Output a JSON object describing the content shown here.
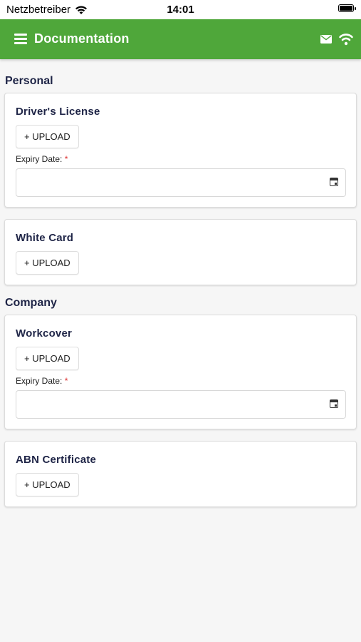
{
  "status_bar": {
    "carrier": "Netzbetreiber",
    "time": "14:01"
  },
  "app_bar": {
    "title": "Documentation",
    "color": "#4fa73a"
  },
  "sections": [
    {
      "title": "Personal",
      "cards": [
        {
          "title": "Driver's License",
          "upload_label": "+ UPLOAD",
          "expiry_label": "Expiry Date:",
          "required_mark": "*",
          "expiry_value": ""
        },
        {
          "title": "White Card",
          "upload_label": "+ UPLOAD"
        }
      ]
    },
    {
      "title": "Company",
      "cards": [
        {
          "title": "Workcover",
          "upload_label": "+ UPLOAD",
          "expiry_label": "Expiry Date:",
          "required_mark": "*",
          "expiry_value": ""
        },
        {
          "title": "ABN Certificate",
          "upload_label": "+ UPLOAD"
        }
      ]
    }
  ],
  "icons": [
    "wifi-icon",
    "battery-icon",
    "menu-icon",
    "mail-icon",
    "calendar-icon"
  ]
}
